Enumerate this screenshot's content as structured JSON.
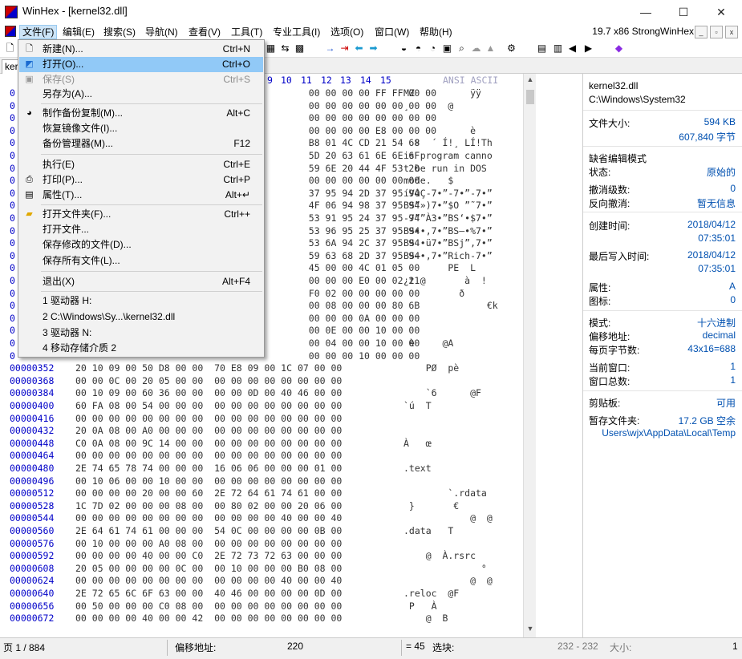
{
  "window": {
    "title": "WinHex - [kernel32.dll]"
  },
  "menubar": {
    "items": [
      "文件(F)",
      "编辑(E)",
      "搜索(S)",
      "导航(N)",
      "查看(V)",
      "工具(T)",
      "专业工具(I)",
      "选项(O)",
      "窗口(W)",
      "帮助(H)"
    ],
    "right_text": "19.7 x86   StrongWinHex"
  },
  "tab": {
    "label": "kernel32.dll"
  },
  "file_menu": {
    "items": [
      {
        "label": "新建(N)...",
        "shortcut": "Ctrl+N",
        "icon": "new-file-icon"
      },
      {
        "label": "打开(O)...",
        "shortcut": "Ctrl+O",
        "icon": "open-icon"
      },
      {
        "label": "保存(S)",
        "shortcut": "Ctrl+S",
        "icon": "save-icon"
      },
      {
        "label": "另存为(A)...",
        "shortcut": "",
        "icon": ""
      },
      {
        "label": "制作备份复制(M)...",
        "shortcut": "Alt+C",
        "icon": "backup-icon"
      },
      {
        "label": "恢复镜像文件(I)...",
        "shortcut": "",
        "icon": ""
      },
      {
        "label": "备份管理器(M)...",
        "shortcut": "F12",
        "icon": ""
      },
      {
        "label": "执行(E)",
        "shortcut": "Ctrl+E",
        "icon": ""
      },
      {
        "label": "打印(P)...",
        "shortcut": "Ctrl+P",
        "icon": "print-icon"
      },
      {
        "label": "属性(T)...",
        "shortcut": "Alt+↵",
        "icon": "properties-icon"
      },
      {
        "label": "打开文件夹(F)...",
        "shortcut": "Ctrl++",
        "icon": "folder-icon"
      },
      {
        "label": "打开文件...",
        "shortcut": "",
        "icon": ""
      },
      {
        "label": "保存修改的文件(D)...",
        "shortcut": "",
        "icon": ""
      },
      {
        "label": "保存所有文件(L)...",
        "shortcut": "",
        "icon": ""
      },
      {
        "label": "退出(X)",
        "shortcut": "Alt+F4",
        "icon": ""
      },
      {
        "label": "1 驱动器 H:",
        "shortcut": "",
        "icon": ""
      },
      {
        "label": "2 C:\\Windows\\Sy...\\kernel32.dll",
        "shortcut": "",
        "icon": ""
      },
      {
        "label": "3 驱动器 N:",
        "shortcut": "",
        "icon": ""
      },
      {
        "label": "4 移动存储介质 2",
        "shortcut": "",
        "icon": ""
      }
    ]
  },
  "hex": {
    "column_headers": [
      "9",
      "10",
      "11",
      "12",
      "13",
      "14",
      "15"
    ],
    "ansi_header": "ANSI ASCII",
    "rows": [
      {
        "o": "0",
        "h": "                                          00 00 00 00 FF FF 00 00",
        "t": "MZ          ÿÿ"
      },
      {
        "o": "0",
        "h": "                                          00 00 00 00 00 00 00 00",
        "t": "¸       @"
      },
      {
        "o": "0",
        "h": "                                          00 00 00 00 00 00 00 00",
        "t": ""
      },
      {
        "o": "0",
        "h": "                                          00 00 00 00 E8 00 00 00",
        "t": "            è"
      },
      {
        "o": "0",
        "h": "                                          B8 01 4C CD 21 54 68",
        "t": "  º  ´ Í!¸ LÍ!Th"
      },
      {
        "o": "0",
        "h": "                                          5D 20 63 61 6E 6E 6F",
        "t": "is program canno"
      },
      {
        "o": "0",
        "h": "                                          59 6E 20 44 4F 53 20",
        "t": "t be run in DOS"
      },
      {
        "o": "0",
        "h": "                                          00 00 00 00 00 00 00",
        "t": "mode.   $"
      },
      {
        "o": "0",
        "h": "                                          37 95 94 2D 37 95 94",
        "t": "íVûÇ-7•”-7•”-7•”"
      },
      {
        "o": "0",
        "h": "                                          4F 06 94 98 37 95 94",
        "t": "BS”»)7•”$O ”˜7•”"
      },
      {
        "o": "0",
        "h": "                                          53 91 95 24 37 95 94",
        "t": "-7””À3•”BS‘•$7•”"
      },
      {
        "o": "0",
        "h": "                                          53 96 95 25 37 95 94",
        "t": "BS••,7•”BS–•%7•”"
      },
      {
        "o": "0",
        "h": "                                          53 6A 94 2C 37 95 94",
        "t": "BS •ü7•”BSj”,7•”"
      },
      {
        "o": "0",
        "h": "                                          59 63 68 2D 37 95 94",
        "t": "BS–•,7•”Rich-7•”"
      },
      {
        "o": "0",
        "h": "                                          45 00 00 4C 01 05 00",
        "t": "        PE  L"
      },
      {
        "o": "0",
        "h": "                                          00 00 00 E0 00 02 21",
        "t": "¿t @       à  !"
      },
      {
        "o": "0",
        "h": "                                          F0 02 00 00 00 00 00",
        "t": "          ð"
      },
      {
        "o": "0",
        "h": "                                          00 08 00 00 00 80 6B",
        "t": "               €k"
      },
      {
        "o": "0",
        "h": "                                          00 00 00 0A 00 00 00",
        "t": ""
      },
      {
        "o": "0",
        "h": "                                          00 0E 00 00 10 00 00",
        "t": ""
      },
      {
        "o": "0",
        "h": "                                          00 04 00 00 10 00 00",
        "t": " è     @A"
      },
      {
        "o": "0",
        "h": "                                          00 00 00 10 00 00 00",
        "t": ""
      },
      {
        "o": "00000352",
        "h": "20 10 09 00 50 D8 00 00  70 E8 09 00 1C 07 00 00",
        "t": "    PØ  pè"
      },
      {
        "o": "00000368",
        "h": "00 00 0C 00 20 05 00 00  00 00 00 00 00 00 00 00",
        "t": ""
      },
      {
        "o": "00000384",
        "h": "00 10 09 00 60 36 00 00  00 00 0D 00 40 46 00 00",
        "t": "    `6      @F"
      },
      {
        "o": "00000400",
        "h": "60 FA 08 00 54 00 00 00  00 00 00 00 00 00 00 00",
        "t": "`ú  T"
      },
      {
        "o": "00000416",
        "h": "00 00 00 00 00 00 00 00  00 00 00 00 00 00 00 00",
        "t": ""
      },
      {
        "o": "00000432",
        "h": "20 0A 08 00 A0 00 00 00  00 00 00 00 00 00 00 00",
        "t": ""
      },
      {
        "o": "00000448",
        "h": "C0 0A 08 00 9C 14 00 00  00 00 00 00 00 00 00 00",
        "t": "À   œ"
      },
      {
        "o": "00000464",
        "h": "00 00 00 00 00 00 00 00  00 00 00 00 00 00 00 00",
        "t": ""
      },
      {
        "o": "00000480",
        "h": "2E 74 65 78 74 00 00 00  16 06 06 00 00 00 01 00",
        "t": ".text"
      },
      {
        "o": "00000496",
        "h": "00 10 06 00 00 10 00 00  00 00 00 00 00 00 00 00",
        "t": ""
      },
      {
        "o": "00000512",
        "h": "00 00 00 00 20 00 00 60  2E 72 64 61 74 61 00 00",
        "t": "        `.rdata"
      },
      {
        "o": "00000528",
        "h": "1C 7D 02 00 00 00 08 00  00 80 02 00 00 20 06 00",
        "t": " }       €"
      },
      {
        "o": "00000544",
        "h": "00 00 00 00 00 00 00 00  00 00 00 00 40 00 00 40",
        "t": "            @  @"
      },
      {
        "o": "00000560",
        "h": "2E 64 61 74 61 00 00 00  54 0C 00 00 00 00 0B 00",
        "t": ".data   T"
      },
      {
        "o": "00000576",
        "h": "00 10 00 00 00 A0 08 00  00 00 00 00 00 00 00 00",
        "t": ""
      },
      {
        "o": "00000592",
        "h": "00 00 00 00 40 00 00 C0  2E 72 73 72 63 00 00 00",
        "t": "    @  À.rsrc"
      },
      {
        "o": "00000608",
        "h": "20 05 00 00 00 00 0C 00  00 10 00 00 00 B0 08 00",
        "t": "              °"
      },
      {
        "o": "00000624",
        "h": "00 00 00 00 00 00 00 00  00 00 00 00 40 00 00 40",
        "t": "            @  @"
      },
      {
        "o": "00000640",
        "h": "2E 72 65 6C 6F 63 00 00  40 46 00 00 00 00 0D 00",
        "t": ".reloc  @F"
      },
      {
        "o": "00000656",
        "h": "00 50 00 00 00 C0 08 00  00 00 00 00 00 00 00 00",
        "t": " P   À"
      },
      {
        "o": "00000672",
        "h": "00 00 00 00 40 00 00 42  00 00 00 00 00 00 00 00",
        "t": "    @  B"
      }
    ]
  },
  "info": {
    "filename": "kernel32.dll",
    "path": "C:\\Windows\\System32",
    "file_size_label": "文件大小:",
    "file_size_kb": "594 KB",
    "file_size_bytes": "607,840 字节",
    "edit_mode_label": "缺省编辑模式",
    "state_label": "状态:",
    "state_value": "原始的",
    "undo_label": "撤消级数:",
    "undo_value": "0",
    "redo_label": "反向撤消:",
    "redo_value": "暂无信息",
    "created_label": "创建时间:",
    "created_date": "2018/04/12",
    "created_time": "07:35:01",
    "modified_label": "最后写入时间:",
    "modified_date": "2018/04/12",
    "modified_time": "07:35:01",
    "attr_label": "属性:",
    "attr_value": "A",
    "icon_label": "图标:",
    "icon_value": "0",
    "mode_label": "模式:",
    "mode_value": "十六进制",
    "offset_label": "偏移地址:",
    "offset_value": "decimal",
    "bpp_label": "每页字节数:",
    "bpp_value": "43x16=688",
    "curwin_label": "当前窗口:",
    "curwin_value": "1",
    "totwin_label": "窗口总数:",
    "totwin_value": "1",
    "clip_label": "剪贴板:",
    "clip_value": "可用",
    "temp_label": "暂存文件夹:",
    "temp_value": "17.2 GB 空余",
    "temp_path": "Users\\wjx\\AppData\\Local\\Temp"
  },
  "status": {
    "page": "页 1 / 884",
    "offset_label": "偏移地址:",
    "offset_value": "220",
    "eq": "= 45",
    "sel_label": "选块:",
    "sel_value": "232 - 232",
    "size_label": "大小:",
    "size_value": "1"
  }
}
